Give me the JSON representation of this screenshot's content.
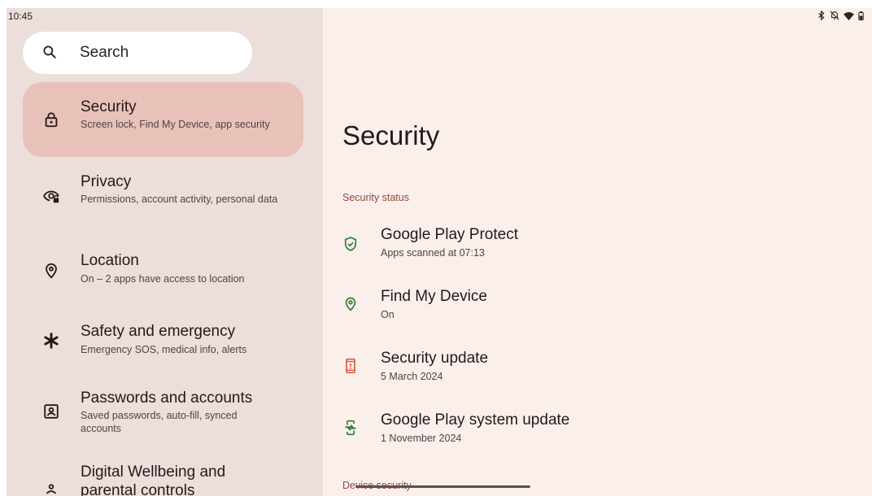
{
  "status_bar": {
    "time": "10:45",
    "icons": [
      "bluetooth-icon",
      "notifications-off-icon",
      "wifi-icon",
      "battery-icon"
    ]
  },
  "search": {
    "label": "Search",
    "icon": "search-icon"
  },
  "sidebar": {
    "items": [
      {
        "title": "Security",
        "subtitle": "Screen lock, Find My Device, app security",
        "icon": "lock-icon",
        "active": true
      },
      {
        "title": "Privacy",
        "subtitle": "Permissions, account activity, personal data",
        "icon": "privacy-eye-icon",
        "active": false
      },
      {
        "title": "Location",
        "subtitle": "On – 2 apps have access to location",
        "icon": "location-pin-icon",
        "active": false
      },
      {
        "title": "Safety and emergency",
        "subtitle": "Emergency SOS, medical info, alerts",
        "icon": "asterisk-icon",
        "active": false
      },
      {
        "title": "Passwords and accounts",
        "subtitle": "Saved passwords, auto-fill, synced accounts",
        "icon": "account-box-icon",
        "active": false
      },
      {
        "title": "Digital Wellbeing and parental controls",
        "subtitle": "",
        "icon": "wellbeing-icon",
        "active": false
      }
    ]
  },
  "main": {
    "title": "Security",
    "sections": [
      {
        "label": "Security status",
        "rows": [
          {
            "title": "Google Play Protect",
            "subtitle": "Apps scanned at 07:13",
            "icon": "shield-check-icon",
            "color": "#2e7d32"
          },
          {
            "title": "Find My Device",
            "subtitle": "On",
            "icon": "location-pin-icon",
            "color": "#2e7d32"
          },
          {
            "title": "Security update",
            "subtitle": "5 March 2024",
            "icon": "phone-alert-icon",
            "color": "#e0553b"
          },
          {
            "title": "Google Play system update",
            "subtitle": "1 November 2024",
            "icon": "phone-update-icon",
            "color": "#2e7d32"
          }
        ]
      },
      {
        "label": "Device security",
        "rows": []
      }
    ]
  },
  "colors": {
    "left_pane_bg": "#ebdedb",
    "right_pane_bg": "#fbefec",
    "active_item_bg": "#e8c2b9",
    "section_label": "#8e4a3c",
    "status_ok": "#2e7d32",
    "status_warn": "#e0553b"
  }
}
